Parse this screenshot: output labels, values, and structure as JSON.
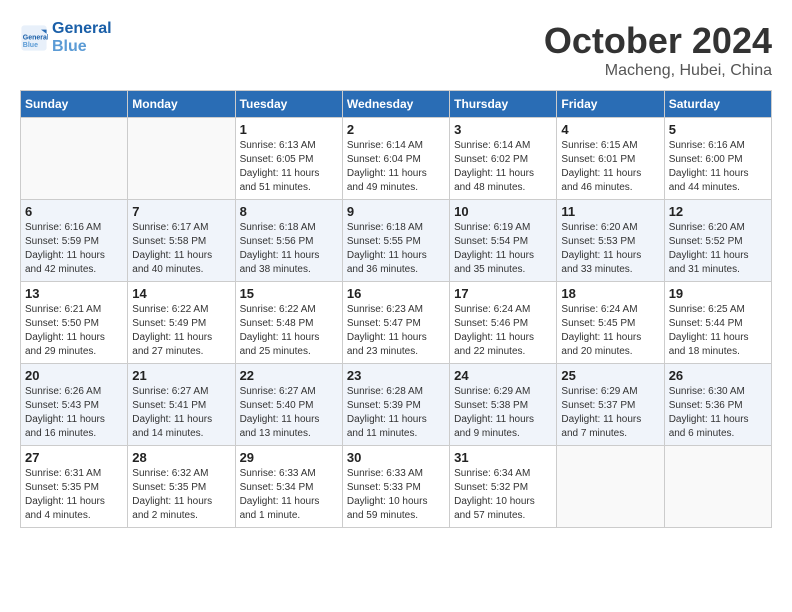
{
  "header": {
    "logo_line1": "General",
    "logo_line2": "Blue",
    "month": "October 2024",
    "location": "Macheng, Hubei, China"
  },
  "weekdays": [
    "Sunday",
    "Monday",
    "Tuesday",
    "Wednesday",
    "Thursday",
    "Friday",
    "Saturday"
  ],
  "weeks": [
    [
      {
        "num": "",
        "info": ""
      },
      {
        "num": "",
        "info": ""
      },
      {
        "num": "1",
        "info": "Sunrise: 6:13 AM\nSunset: 6:05 PM\nDaylight: 11 hours and 51 minutes."
      },
      {
        "num": "2",
        "info": "Sunrise: 6:14 AM\nSunset: 6:04 PM\nDaylight: 11 hours and 49 minutes."
      },
      {
        "num": "3",
        "info": "Sunrise: 6:14 AM\nSunset: 6:02 PM\nDaylight: 11 hours and 48 minutes."
      },
      {
        "num": "4",
        "info": "Sunrise: 6:15 AM\nSunset: 6:01 PM\nDaylight: 11 hours and 46 minutes."
      },
      {
        "num": "5",
        "info": "Sunrise: 6:16 AM\nSunset: 6:00 PM\nDaylight: 11 hours and 44 minutes."
      }
    ],
    [
      {
        "num": "6",
        "info": "Sunrise: 6:16 AM\nSunset: 5:59 PM\nDaylight: 11 hours and 42 minutes."
      },
      {
        "num": "7",
        "info": "Sunrise: 6:17 AM\nSunset: 5:58 PM\nDaylight: 11 hours and 40 minutes."
      },
      {
        "num": "8",
        "info": "Sunrise: 6:18 AM\nSunset: 5:56 PM\nDaylight: 11 hours and 38 minutes."
      },
      {
        "num": "9",
        "info": "Sunrise: 6:18 AM\nSunset: 5:55 PM\nDaylight: 11 hours and 36 minutes."
      },
      {
        "num": "10",
        "info": "Sunrise: 6:19 AM\nSunset: 5:54 PM\nDaylight: 11 hours and 35 minutes."
      },
      {
        "num": "11",
        "info": "Sunrise: 6:20 AM\nSunset: 5:53 PM\nDaylight: 11 hours and 33 minutes."
      },
      {
        "num": "12",
        "info": "Sunrise: 6:20 AM\nSunset: 5:52 PM\nDaylight: 11 hours and 31 minutes."
      }
    ],
    [
      {
        "num": "13",
        "info": "Sunrise: 6:21 AM\nSunset: 5:50 PM\nDaylight: 11 hours and 29 minutes."
      },
      {
        "num": "14",
        "info": "Sunrise: 6:22 AM\nSunset: 5:49 PM\nDaylight: 11 hours and 27 minutes."
      },
      {
        "num": "15",
        "info": "Sunrise: 6:22 AM\nSunset: 5:48 PM\nDaylight: 11 hours and 25 minutes."
      },
      {
        "num": "16",
        "info": "Sunrise: 6:23 AM\nSunset: 5:47 PM\nDaylight: 11 hours and 23 minutes."
      },
      {
        "num": "17",
        "info": "Sunrise: 6:24 AM\nSunset: 5:46 PM\nDaylight: 11 hours and 22 minutes."
      },
      {
        "num": "18",
        "info": "Sunrise: 6:24 AM\nSunset: 5:45 PM\nDaylight: 11 hours and 20 minutes."
      },
      {
        "num": "19",
        "info": "Sunrise: 6:25 AM\nSunset: 5:44 PM\nDaylight: 11 hours and 18 minutes."
      }
    ],
    [
      {
        "num": "20",
        "info": "Sunrise: 6:26 AM\nSunset: 5:43 PM\nDaylight: 11 hours and 16 minutes."
      },
      {
        "num": "21",
        "info": "Sunrise: 6:27 AM\nSunset: 5:41 PM\nDaylight: 11 hours and 14 minutes."
      },
      {
        "num": "22",
        "info": "Sunrise: 6:27 AM\nSunset: 5:40 PM\nDaylight: 11 hours and 13 minutes."
      },
      {
        "num": "23",
        "info": "Sunrise: 6:28 AM\nSunset: 5:39 PM\nDaylight: 11 hours and 11 minutes."
      },
      {
        "num": "24",
        "info": "Sunrise: 6:29 AM\nSunset: 5:38 PM\nDaylight: 11 hours and 9 minutes."
      },
      {
        "num": "25",
        "info": "Sunrise: 6:29 AM\nSunset: 5:37 PM\nDaylight: 11 hours and 7 minutes."
      },
      {
        "num": "26",
        "info": "Sunrise: 6:30 AM\nSunset: 5:36 PM\nDaylight: 11 hours and 6 minutes."
      }
    ],
    [
      {
        "num": "27",
        "info": "Sunrise: 6:31 AM\nSunset: 5:35 PM\nDaylight: 11 hours and 4 minutes."
      },
      {
        "num": "28",
        "info": "Sunrise: 6:32 AM\nSunset: 5:35 PM\nDaylight: 11 hours and 2 minutes."
      },
      {
        "num": "29",
        "info": "Sunrise: 6:33 AM\nSunset: 5:34 PM\nDaylight: 11 hours and 1 minute."
      },
      {
        "num": "30",
        "info": "Sunrise: 6:33 AM\nSunset: 5:33 PM\nDaylight: 10 hours and 59 minutes."
      },
      {
        "num": "31",
        "info": "Sunrise: 6:34 AM\nSunset: 5:32 PM\nDaylight: 10 hours and 57 minutes."
      },
      {
        "num": "",
        "info": ""
      },
      {
        "num": "",
        "info": ""
      }
    ]
  ]
}
